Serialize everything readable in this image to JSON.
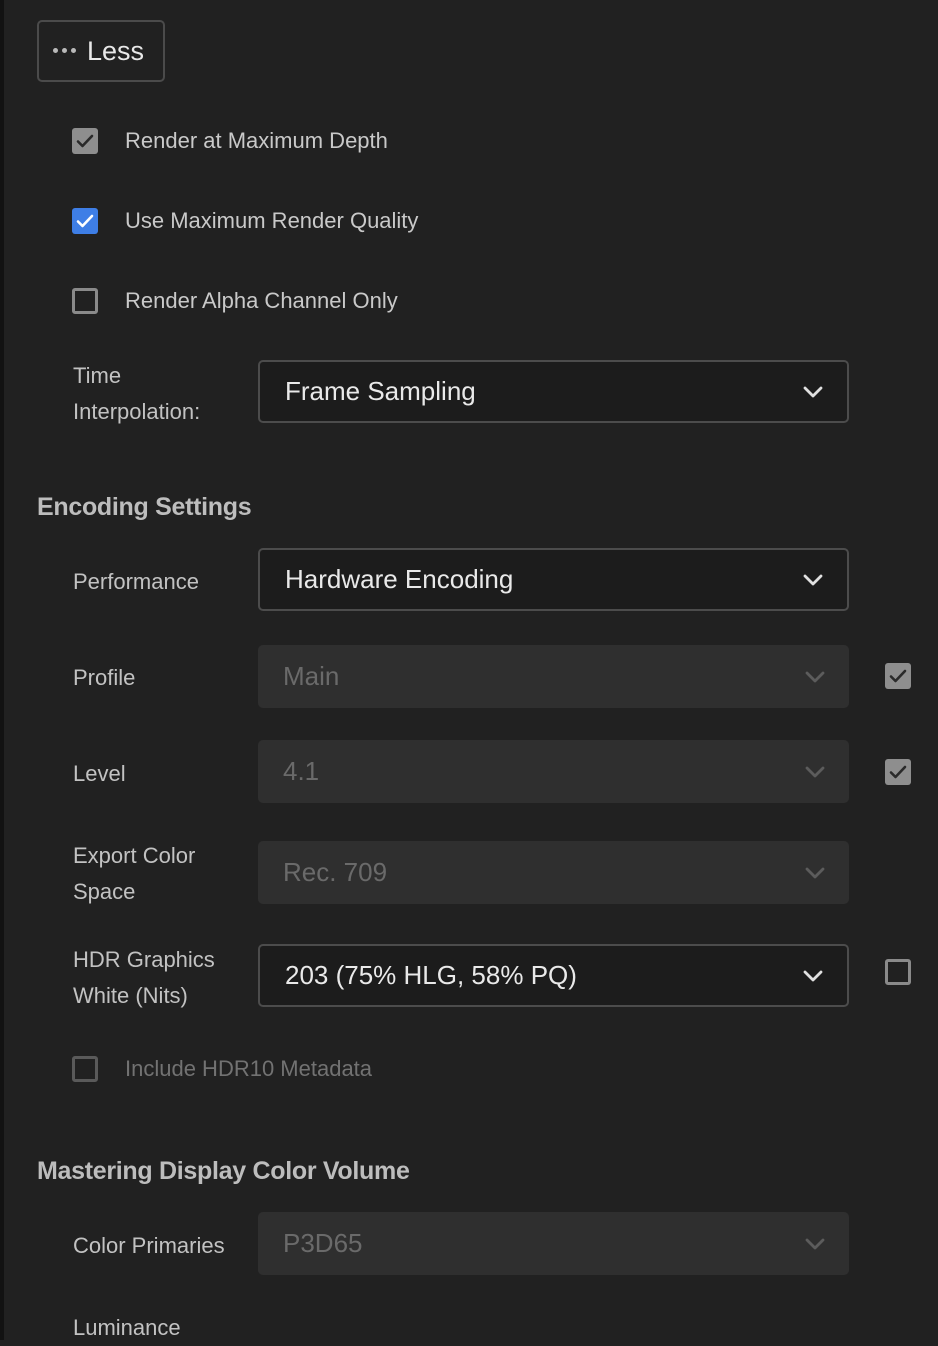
{
  "toolbar": {
    "less_label": "Less",
    "more_icon": "ellipsis-icon"
  },
  "checks": {
    "render_max_depth": {
      "label": "Render at Maximum Depth",
      "checked": true
    },
    "max_render_quality": {
      "label": "Use Maximum Render Quality",
      "checked": true,
      "color": "#3e7ee6"
    },
    "alpha_only": {
      "label": "Render Alpha Channel Only",
      "checked": false
    },
    "hdr10_metadata": {
      "label": "Include HDR10 Metadata",
      "checked": false,
      "disabled": true
    }
  },
  "time_interpolation": {
    "label_line1": "Time",
    "label_line2": "Interpolation:",
    "value": "Frame Sampling"
  },
  "encoding_settings": {
    "title": "Encoding Settings",
    "performance": {
      "label": "Performance",
      "value": "Hardware Encoding"
    },
    "profile": {
      "label": "Profile",
      "value": "Main",
      "disabled": true,
      "override_checked": true
    },
    "level": {
      "label": "Level",
      "value": "4.1",
      "disabled": true,
      "override_checked": true
    },
    "export_color_space": {
      "label_line1": "Export Color",
      "label_line2": "Space",
      "value": "Rec. 709",
      "disabled": true
    },
    "hdr_graphics_white": {
      "label_line1": "HDR Graphics",
      "label_line2": "White (Nits)",
      "value": "203 (75% HLG, 58% PQ)",
      "override_checked": false
    }
  },
  "mastering": {
    "title": "Mastering Display Color Volume",
    "color_primaries": {
      "label": "Color Primaries",
      "value": "P3D65",
      "disabled": true
    },
    "luminance": {
      "label": "Luminance"
    }
  },
  "colors": {
    "background": "#212121",
    "accent": "#3e7ee6"
  }
}
